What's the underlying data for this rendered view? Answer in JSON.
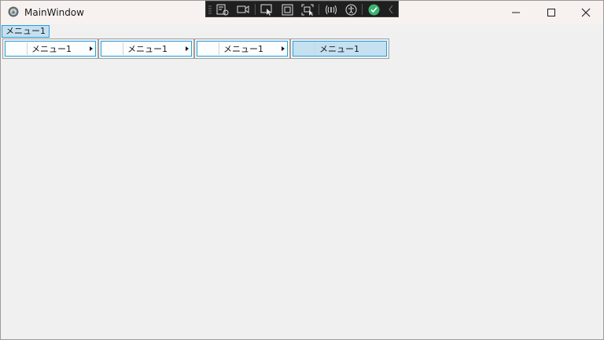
{
  "window": {
    "title": "MainWindow",
    "app_icon": "wpf-app-icon",
    "caption_buttons": [
      "minimize-icon",
      "maximize-icon",
      "close-icon"
    ]
  },
  "debug_toolbar": {
    "icons": [
      "go-to-live-visual-tree-icon",
      "select-element-icon",
      "display-layout-adorners-icon",
      "track-focused-element-icon",
      "binding-failures-icon",
      "accessibility-scanner-icon",
      "hot-reload-ok-icon",
      "collapse-toolbar-icon"
    ]
  },
  "menu": {
    "top_item": "メニュー1",
    "cascade": [
      {
        "label": "メニュー1",
        "has_submenu": true,
        "highlighted": false
      },
      {
        "label": "メニュー1",
        "has_submenu": true,
        "highlighted": false
      },
      {
        "label": "メニュー1",
        "has_submenu": true,
        "highlighted": false
      },
      {
        "label": "メニュー1",
        "has_submenu": false,
        "highlighted": true
      }
    ]
  },
  "colors": {
    "highlight_fill": "#c4e0f1",
    "highlight_border": "#26a0da",
    "window_bg": "#f0f0f0",
    "titlebar_bg": "#f7f2ef",
    "toolbar_bg": "#1f1f1f",
    "hot_reload_ok": "#3cb371"
  }
}
